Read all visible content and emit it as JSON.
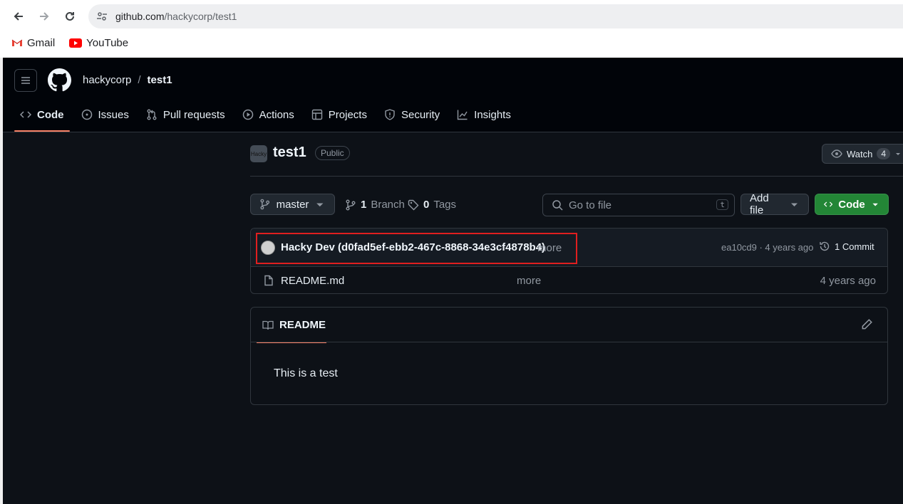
{
  "browser": {
    "url_host": "github.com",
    "url_path": "/hackycorp/test1",
    "bookmarks": [
      {
        "label": "Gmail",
        "icon": "gmail-icon"
      },
      {
        "label": "YouTube",
        "icon": "youtube-icon"
      }
    ]
  },
  "header": {
    "owner": "hackycorp",
    "separator": "/",
    "repo": "test1",
    "tabs": [
      {
        "label": "Code",
        "icon": "code-icon",
        "active": true
      },
      {
        "label": "Issues",
        "icon": "issue-icon"
      },
      {
        "label": "Pull requests",
        "icon": "pull-request-icon"
      },
      {
        "label": "Actions",
        "icon": "play-icon"
      },
      {
        "label": "Projects",
        "icon": "table-icon"
      },
      {
        "label": "Security",
        "icon": "shield-icon"
      },
      {
        "label": "Insights",
        "icon": "graph-icon"
      }
    ]
  },
  "repo": {
    "avatar_text": "Hacky",
    "name": "test1",
    "visibility": "Public",
    "watch_label": "Watch",
    "watch_count": "4"
  },
  "toolbar": {
    "branch": "master",
    "branch_count": "1",
    "branch_label": "Branch",
    "tag_count": "0",
    "tag_label": "Tags",
    "go_to_file_placeholder": "Go to file",
    "go_to_file_shortcut": "t",
    "add_file_label": "Add file",
    "code_label": "Code"
  },
  "commit": {
    "author_message": "Hacky Dev (d0fad5ef-ebb2-467c-8868-34e3cf4878b4)",
    "more": "more",
    "hash_age": "ea10cd9 · 4 years ago",
    "commit_count": "1 Commit"
  },
  "files": [
    {
      "name": "README.md",
      "more": "more",
      "age": "4 years ago"
    }
  ],
  "readme": {
    "tab_label": "README",
    "content": "This is a test"
  },
  "colors": {
    "accent_tab_underline": "#f78166",
    "code_button": "#238636",
    "highlight_box": "#e01f1f"
  }
}
